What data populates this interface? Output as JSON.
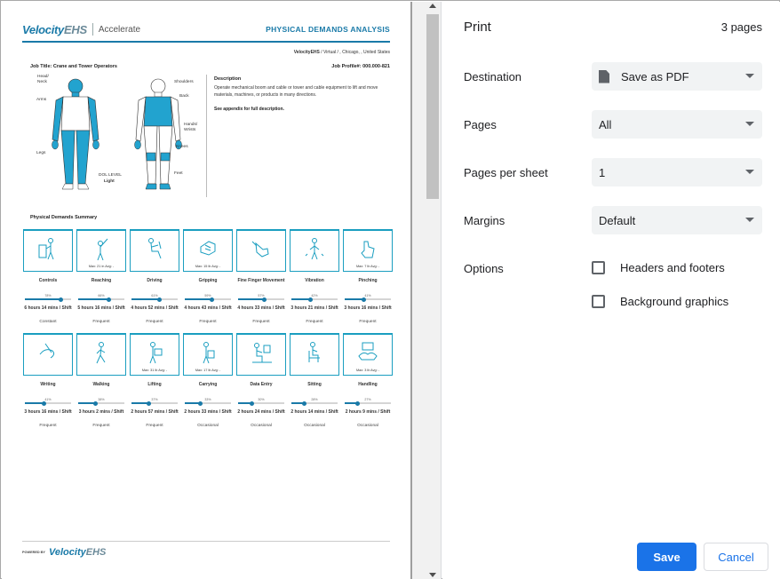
{
  "print": {
    "title": "Print",
    "page_count": "3 pages",
    "destination": {
      "label": "Destination",
      "value": "Save as PDF"
    },
    "pages": {
      "label": "Pages",
      "value": "All"
    },
    "pages_per_sheet": {
      "label": "Pages per sheet",
      "value": "1"
    },
    "margins": {
      "label": "Margins",
      "value": "Default"
    },
    "options": {
      "label": "Options",
      "headers_footers": "Headers and footers",
      "background_graphics": "Background graphics"
    },
    "save_label": "Save",
    "cancel_label": "Cancel"
  },
  "doc": {
    "brand_main": "Velocity",
    "brand_accent": "EHS",
    "brand_sub": "Accelerate",
    "title": "PHYSICAL DEMANDS ANALYSIS",
    "location_bold": "VelocityEHS",
    "location_rest": " / Virtual / , Chicago, , United States",
    "job_title": "Job Title: Crane and Tower Operators",
    "job_profile": "Job Profile#: 000.000-821",
    "body_labels": {
      "head_neck": "Head/ Neck",
      "arms": "Arms",
      "legs": "Legs",
      "shoulders": "Shoulders",
      "back": "Back",
      "hands_wrists": "Hands/ Wrists",
      "knees": "Knees",
      "feet": "Feet",
      "dol_level": "DOL LEVEL",
      "dol_value": "Light"
    },
    "description_title": "Description",
    "description_text": "Operate mechanical boom and cable or tower and cable equipment to lift and move materials, machines, or products in many directions.",
    "description_append": "See appendix for full description.",
    "summary_title": "Physical Demands Summary",
    "powered_by": "POWERED BY",
    "demands_row1": [
      {
        "name": "Controls",
        "max": "",
        "pct": "78%",
        "level": 0.78,
        "time": "6 hours 14 mins / Shift",
        "freq": "Constant",
        "icon": "controls-icon"
      },
      {
        "name": "Reaching",
        "max": "Max: 21 in Avg: -",
        "pct": "66%",
        "level": 0.66,
        "time": "5 hours 16 mins / Shift",
        "freq": "Frequent",
        "icon": "reaching-icon"
      },
      {
        "name": "Driving",
        "max": "",
        "pct": "61%",
        "level": 0.61,
        "time": "4 hours 52 mins / Shift",
        "freq": "Frequent",
        "icon": "driving-icon"
      },
      {
        "name": "Gripping",
        "max": "Max: 15 lb Avg: -",
        "pct": "59%",
        "level": 0.59,
        "time": "4 hours 43 mins / Shift",
        "freq": "Frequent",
        "icon": "gripping-icon"
      },
      {
        "name": "Fine Finger Movement",
        "max": "",
        "pct": "57%",
        "level": 0.57,
        "time": "4 hours 33 mins / Shift",
        "freq": "Frequent",
        "icon": "fine-finger-icon"
      },
      {
        "name": "Vibration",
        "max": "",
        "pct": "42%",
        "level": 0.42,
        "time": "3 hours 21 mins / Shift",
        "freq": "Frequent",
        "icon": "vibration-icon"
      },
      {
        "name": "Pinching",
        "max": "Max: 7 lb Avg: -",
        "pct": "41%",
        "level": 0.41,
        "time": "3 hours 16 mins / Shift",
        "freq": "Frequent",
        "icon": "pinching-icon"
      }
    ],
    "demands_row2": [
      {
        "name": "Writing",
        "max": "",
        "pct": "41%",
        "level": 0.41,
        "time": "3 hours 16 mins / Shift",
        "freq": "Frequent",
        "icon": "writing-icon"
      },
      {
        "name": "Walking",
        "max": "",
        "pct": "38%",
        "level": 0.38,
        "time": "3 hours 2 mins / Shift",
        "freq": "Frequent",
        "icon": "walking-icon"
      },
      {
        "name": "Lifting",
        "max": "Max: 31 lb Avg: -",
        "pct": "37%",
        "level": 0.37,
        "time": "2 hours 57 mins / Shift",
        "freq": "Frequent",
        "icon": "lifting-icon"
      },
      {
        "name": "Carrying",
        "max": "Max: 17 lb Avg: -",
        "pct": "33%",
        "level": 0.33,
        "time": "2 hours 33 mins / Shift",
        "freq": "Occasional",
        "icon": "carrying-icon"
      },
      {
        "name": "Data Entry",
        "max": "",
        "pct": "30%",
        "level": 0.3,
        "time": "2 hours 24 mins / Shift",
        "freq": "Occasional",
        "icon": "data-entry-icon"
      },
      {
        "name": "Sitting",
        "max": "",
        "pct": "28%",
        "level": 0.28,
        "time": "2 hours 14 mins / Shift",
        "freq": "Occasional",
        "icon": "sitting-icon"
      },
      {
        "name": "Handling",
        "max": "Max: 3 lb Avg: -",
        "pct": "27%",
        "level": 0.27,
        "time": "2 hours 9 mins / Shift",
        "freq": "Occasional",
        "icon": "handling-icon"
      }
    ]
  },
  "colors": {
    "brand": "#1a7aa8",
    "accent": "#1a73e8",
    "body_highlight": "#22a3cf"
  }
}
